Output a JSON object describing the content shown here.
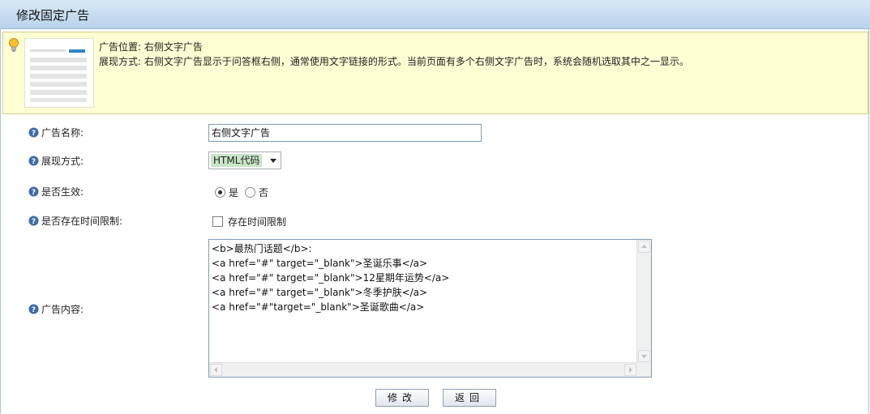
{
  "header": {
    "title": "修改固定广告"
  },
  "notice": {
    "position_line": "广告位置: 右侧文字广告",
    "display_line": "展现方式: 右侧文字广告显示于问答框右侧，通常使用文字链接的形式。当前页面有多个右侧文字广告时，系统会随机选取其中之一显示。"
  },
  "form": {
    "name_label": "广告名称:",
    "name_value": "右侧文字广告",
    "display_label": "展现方式:",
    "display_value": "HTML代码",
    "active_label": "是否生效:",
    "active_yes": "是",
    "active_no": "否",
    "active_selected": "是",
    "time_label": "是否存在时间限制:",
    "time_checkbox_label": "存在时间限制",
    "time_checked": false,
    "content_label": "广告内容:",
    "content_lines": [
      "<b>最热门话题</b>:",
      "<a href=\"#\" target=\"_blank\">圣诞乐事</a>",
      "<a href=\"#\" target=\"_blank\">12星期年运势</a>",
      "<a href=\"#\" target=\"_blank\">冬季护肤</a>",
      "<a href=\"#\"target=\"_blank\">圣诞歌曲</a>"
    ]
  },
  "buttons": {
    "submit": "修改",
    "back": "返回"
  },
  "colors": {
    "header_bg": "#c6dbef",
    "notice_bg": "#fefed3",
    "accent": "#2d86c8"
  },
  "icons": [
    "lightbulb-icon",
    "help-icon"
  ]
}
